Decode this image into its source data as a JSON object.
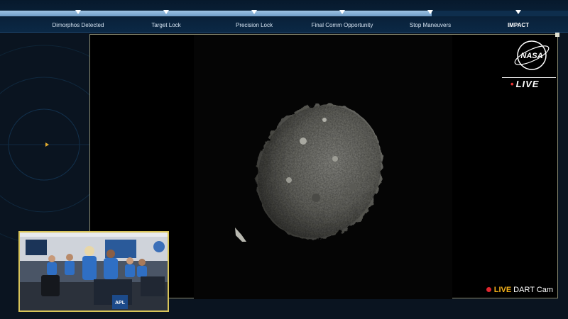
{
  "timeline": {
    "progress_percent": 76,
    "milestones": [
      {
        "label": "Dimorphos Detected"
      },
      {
        "label": "Target Lock"
      },
      {
        "label": "Precision Lock"
      },
      {
        "label": "Final Comm Opportunity"
      },
      {
        "label": "Stop Maneuvers"
      },
      {
        "label": "IMPACT"
      }
    ]
  },
  "video": {
    "logo_text": "NASA",
    "live_badge": "LIVE",
    "cam_live": "LIVE",
    "cam_name": "DART Cam"
  },
  "pip": {
    "flag_text": "APL"
  },
  "colors": {
    "accent_gold": "#d8c45a",
    "live_red": "#e0262e",
    "live_yellow": "#f5b21a",
    "nasa_blue": "#0b3d91"
  }
}
